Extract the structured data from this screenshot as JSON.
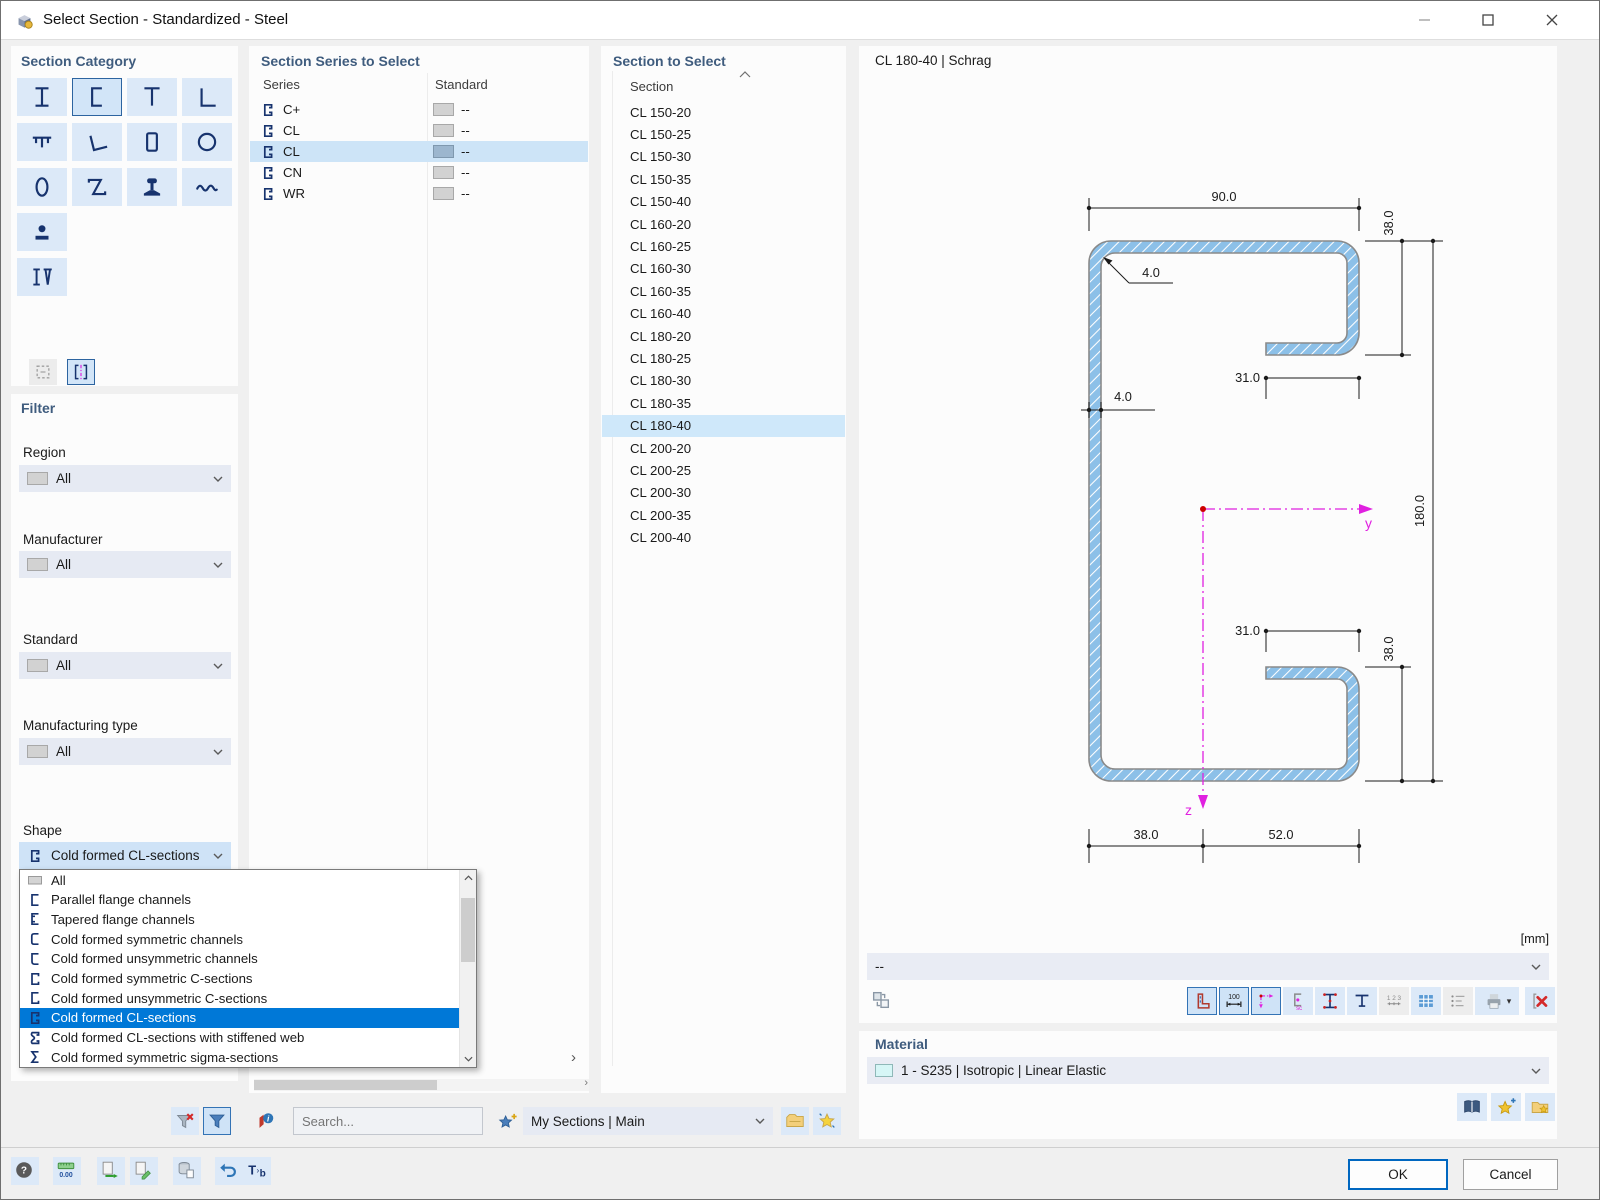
{
  "window": {
    "title": "Select Section - Standardized - Steel"
  },
  "panels": {
    "category": {
      "title": "Section Category",
      "items": [
        {
          "icon": "i-section"
        },
        {
          "icon": "c-channel"
        },
        {
          "icon": "t-section"
        },
        {
          "icon": "l-angle"
        },
        {
          "icon": "hat-section"
        },
        {
          "icon": "angle-section"
        },
        {
          "icon": "box-section"
        },
        {
          "icon": "pipe-section"
        },
        {
          "icon": "oval-section"
        },
        {
          "icon": "z-section"
        },
        {
          "icon": "rail-section"
        },
        {
          "icon": "corrugated-section"
        },
        {
          "icon": "bar-plate-section"
        },
        {
          "icon": "built-up-section"
        }
      ],
      "selected": 1,
      "footer": [
        {
          "icon": "frame-dashed",
          "state": "disabled"
        },
        {
          "icon": "bracket-axis",
          "state": "selected"
        }
      ]
    },
    "filter": {
      "title": "Filter",
      "fields": [
        {
          "label": "Region",
          "value": "All"
        },
        {
          "label": "Manufacturer",
          "value": "All"
        },
        {
          "label": "Standard",
          "value": "All"
        },
        {
          "label": "Manufacturing type",
          "value": "All"
        }
      ],
      "shape_label": "Shape",
      "shape_value": "Cold formed CL-sections",
      "shape_icon": "cf-cl"
    },
    "series": {
      "title": "Section Series to Select",
      "col_series": "Series",
      "col_standard": "Standard",
      "rows": [
        {
          "name": "C+",
          "standard": "--"
        },
        {
          "name": "CL",
          "standard": "--"
        },
        {
          "name": "CL",
          "standard": "--"
        },
        {
          "name": "CN",
          "standard": "--"
        },
        {
          "name": "WR",
          "standard": "--"
        }
      ],
      "selected": 2
    },
    "sections": {
      "title": "Section to Select",
      "column": "Section",
      "rows": [
        "CL 150-20",
        "CL 150-25",
        "CL 150-30",
        "CL 150-35",
        "CL 150-40",
        "CL 160-20",
        "CL 160-25",
        "CL 160-30",
        "CL 160-35",
        "CL 160-40",
        "CL 180-20",
        "CL 180-25",
        "CL 180-30",
        "CL 180-35",
        "CL 180-40",
        "CL 200-20",
        "CL 200-25",
        "CL 200-30",
        "CL 200-35",
        "CL 200-40"
      ],
      "selected": 14
    },
    "preview": {
      "caption": "CL 180-40 | Schrag",
      "units": "[mm]",
      "combo_value": "--",
      "dims": {
        "width_top": "90.0",
        "lip_top": "38.0",
        "radius": "4.0",
        "thickness": "4.0",
        "return_top": "31.0",
        "return_bottom": "31.0",
        "lip_bottom": "38.0",
        "height": "180.0",
        "bottom_left": "38.0",
        "bottom_right": "52.0"
      },
      "axes": {
        "y": "y",
        "z": "z"
      }
    },
    "material": {
      "title": "Material",
      "value": "1 - S235 | Isotropic | Linear Elastic"
    }
  },
  "shape_dropdown": {
    "items": [
      {
        "icon": "all",
        "label": "All"
      },
      {
        "icon": "ch-parallel",
        "label": "Parallel flange channels"
      },
      {
        "icon": "ch-tapered",
        "label": "Tapered flange channels"
      },
      {
        "icon": "cf-sym-ch",
        "label": "Cold formed symmetric channels"
      },
      {
        "icon": "cf-unsym-ch",
        "label": "Cold formed unsymmetric channels"
      },
      {
        "icon": "cf-sym-c",
        "label": "Cold formed symmetric C-sections"
      },
      {
        "icon": "cf-unsym-c",
        "label": "Cold formed unsymmetric C-sections"
      },
      {
        "icon": "cf-cl",
        "label": "Cold formed CL-sections"
      },
      {
        "icon": "cf-cl-stiff",
        "label": "Cold formed CL-sections with stiffened web"
      },
      {
        "icon": "cf-sigma",
        "label": "Cold formed symmetric sigma-sections"
      }
    ],
    "selected": 7
  },
  "preview_toolbar": [
    {
      "icon": "show-outline",
      "state": "sel"
    },
    {
      "icon": "show-dimensions",
      "state": "sel"
    },
    {
      "icon": "show-axes",
      "state": "sel"
    },
    {
      "icon": "show-shear-center",
      "state": ""
    },
    {
      "icon": "show-stress-points",
      "state": ""
    },
    {
      "icon": "show-section-plain",
      "state": ""
    },
    {
      "icon": "show-numbering",
      "state": "dis"
    },
    {
      "icon": "show-table",
      "state": ""
    },
    {
      "icon": "show-details",
      "state": "dis"
    },
    {
      "icon": "print",
      "state": "",
      "caret": true
    },
    {
      "icon": "remove-section",
      "state": ""
    }
  ],
  "material_toolbar": [
    "material-library",
    "material-new",
    "material-favorite"
  ],
  "bottom_toolbar": [
    "help",
    "units",
    "export-data",
    "send-edit",
    "database-copy",
    "undo",
    "text-format"
  ],
  "favorites": {
    "search_placeholder": "Search...",
    "group": "My Sections | Main",
    "icons": [
      {
        "icon": "filter-delete",
        "state": ""
      },
      {
        "icon": "filter-apply",
        "state": "sel"
      },
      {
        "icon": "info-section",
        "state": "flat"
      },
      {
        "icon": "favorite-add",
        "state": "flat"
      },
      {
        "icon": "group-open",
        "state": ""
      },
      {
        "icon": "group-new",
        "state": ""
      }
    ]
  },
  "actions": {
    "ok": "OK",
    "cancel": "Cancel"
  },
  "colors": {
    "accent": "#0078d7",
    "selection": "#cde4f7",
    "glyph": "#17336e",
    "section_fill": "#8cc0e8",
    "axis": "#e020e0",
    "centroid": "#cc0000"
  }
}
